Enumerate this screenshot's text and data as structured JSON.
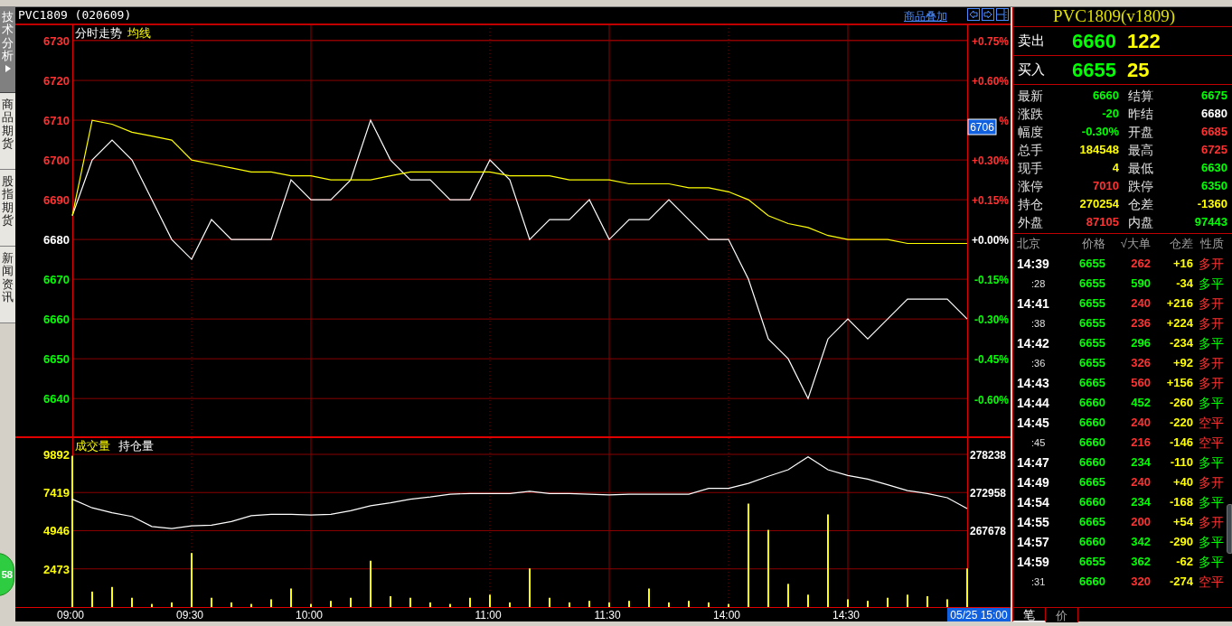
{
  "sidebar": {
    "tabs": [
      {
        "label": "技术分析",
        "selected": true
      },
      {
        "label": "商品期货",
        "selected": false
      },
      {
        "label": "股指期货",
        "selected": false
      },
      {
        "label": "新闻资讯",
        "selected": false
      }
    ],
    "badge": "58"
  },
  "header": {
    "title": "PVC1809 (020609)",
    "overlay_link": "商品叠加"
  },
  "price_chart": {
    "cursor_price": "6706",
    "chart_data": {
      "type": "line",
      "grid": true,
      "ylim": [
        6630.5,
        6734.1
      ],
      "y2lim": [
        -0.741,
        0.81
      ],
      "yticks": [
        {
          "value": 6730,
          "label": "6730"
        },
        {
          "value": 6720,
          "label": "6720"
        },
        {
          "value": 6710,
          "label": "6710"
        },
        {
          "value": 6700,
          "label": "6700"
        },
        {
          "value": 6690,
          "label": "6690"
        },
        {
          "value": 6680,
          "label": "6680"
        },
        {
          "value": 6670,
          "label": "6670"
        },
        {
          "value": 6660,
          "label": "6660"
        },
        {
          "value": 6650,
          "label": "6650"
        },
        {
          "value": 6640,
          "label": "6640"
        }
      ],
      "y2ticks": [
        {
          "value": 0.75,
          "label": "+0.75%"
        },
        {
          "value": 0.6,
          "label": "+0.60%"
        },
        {
          "value": 0.45,
          "label": "%"
        },
        {
          "value": 0.3,
          "label": "+0.30%"
        },
        {
          "value": 0.15,
          "label": "+0.15%"
        },
        {
          "value": 0,
          "label": "+0.00%"
        },
        {
          "value": -0.15,
          "label": "-0.15%"
        },
        {
          "value": -0.3,
          "label": "-0.30%"
        },
        {
          "value": -0.45,
          "label": "-0.45%"
        },
        {
          "value": -0.6,
          "label": "-0.60%"
        }
      ],
      "series": [
        {
          "name": "分时走势",
          "color": "#ffffff",
          "values": [
            6686,
            6700,
            6705,
            6700,
            6690,
            6680,
            6675,
            6685,
            6680,
            6680,
            6680,
            6695,
            6690,
            6690,
            6695,
            6710,
            6700,
            6695,
            6695,
            6690,
            6690,
            6700,
            6695,
            6680,
            6685,
            6685,
            6690,
            6680,
            6685,
            6685,
            6690,
            6685,
            6680,
            6680,
            6670,
            6655,
            6650,
            6640,
            6655,
            6660,
            6655,
            6660,
            6665,
            6665,
            6665,
            6660
          ]
        },
        {
          "name": "均线",
          "color": "#ffff00",
          "values": [
            6686,
            6710,
            6709,
            6707,
            6706,
            6705,
            6700,
            6699,
            6698,
            6697,
            6697,
            6696,
            6696,
            6695,
            6695,
            6695,
            6696,
            6697,
            6697,
            6697,
            6697,
            6697,
            6696,
            6696,
            6696,
            6695,
            6695,
            6695,
            6694,
            6694,
            6694,
            6693,
            6693,
            6692,
            6690,
            6686,
            6684,
            6683,
            6681,
            6680,
            6680,
            6680,
            6679,
            6679,
            6679,
            6679
          ]
        }
      ]
    }
  },
  "volume_chart": {
    "time_label": "05/25 15:00",
    "chart_data": {
      "type": "bar",
      "categories": [
        "09:00",
        null,
        null,
        null,
        null,
        null,
        "09:30",
        null,
        null,
        null,
        null,
        null,
        "10:00",
        null,
        null,
        null,
        null,
        null,
        null,
        null,
        null,
        "11:00",
        null,
        null,
        null,
        null,
        null,
        "11:30",
        null,
        null,
        null,
        null,
        null,
        "14:00",
        null,
        null,
        null,
        null,
        null,
        "14:30",
        null,
        null,
        null,
        null,
        null,
        null
      ],
      "grid": true,
      "ylim": [
        0,
        10828
      ],
      "y2lim": [
        256994,
        280249
      ],
      "yticks": [
        {
          "value": 9892,
          "label": "9892"
        },
        {
          "value": 7419,
          "label": "7419"
        },
        {
          "value": 4946,
          "label": "4946"
        },
        {
          "value": 2473,
          "label": "2473"
        }
      ],
      "y2ticks": [
        {
          "value": 278238,
          "label": "278238"
        },
        {
          "value": 272958,
          "label": "272958"
        },
        {
          "value": 267678,
          "label": "267678"
        }
      ],
      "series": [
        {
          "name": "成交量",
          "color": "#ffff00",
          "values": [
            9800,
            1000,
            1300,
            600,
            200,
            300,
            3500,
            600,
            300,
            200,
            500,
            1200,
            200,
            400,
            600,
            3000,
            700,
            600,
            300,
            200,
            600,
            800,
            300,
            2500,
            600,
            300,
            400,
            300,
            400,
            1200,
            300,
            400,
            300,
            200,
            6700,
            5000,
            1500,
            800,
            6000,
            500,
            400,
            600,
            800,
            700,
            500,
            2500
          ]
        },
        {
          "name": "持仓量",
          "color": "#ffffff",
          "type": "line",
          "axis": "y2",
          "values": [
            272000,
            270800,
            270100,
            269600,
            268200,
            267900,
            268300,
            268400,
            268900,
            269700,
            269900,
            269900,
            269800,
            269900,
            270400,
            271100,
            271500,
            272000,
            272300,
            272700,
            272800,
            272800,
            272800,
            273100,
            272800,
            272800,
            272700,
            272600,
            272700,
            272700,
            272700,
            272700,
            273500,
            273500,
            274200,
            275200,
            276100,
            277900,
            276100,
            275300,
            274800,
            274000,
            273200,
            272800,
            272200,
            270700
          ]
        }
      ]
    }
  },
  "quote": {
    "title": "PVC1809(v1809)",
    "ask": {
      "label": "卖出",
      "price": "6660",
      "volume": "122"
    },
    "bid": {
      "label": "买入",
      "price": "6655",
      "volume": "25"
    },
    "stats": [
      {
        "label": "最新",
        "value": "6660",
        "color": "#00ff00"
      },
      {
        "label": "结算",
        "value": "6675",
        "color": "#00ff00"
      },
      {
        "label": "涨跌",
        "value": "-20",
        "color": "#00ff00"
      },
      {
        "label": "昨结",
        "value": "6680",
        "color": "#ffffff"
      },
      {
        "label": "幅度",
        "value": "-0.30%",
        "color": "#00ff00"
      },
      {
        "label": "开盘",
        "value": "6685",
        "color": "#ff3232"
      },
      {
        "label": "总手",
        "value": "184548",
        "color": "#ffff00"
      },
      {
        "label": "最高",
        "value": "6725",
        "color": "#ff3232"
      },
      {
        "label": "现手",
        "value": "4",
        "color": "#ffff00"
      },
      {
        "label": "最低",
        "value": "6630",
        "color": "#00ff00"
      },
      {
        "label": "涨停",
        "value": "7010",
        "color": "#ff3232"
      },
      {
        "label": "跌停",
        "value": "6350",
        "color": "#00ff00"
      },
      {
        "label": "持仓",
        "value": "270254",
        "color": "#ffff00"
      },
      {
        "label": "仓差",
        "value": "-1360",
        "color": "#ffff00"
      },
      {
        "label": "外盘",
        "value": "87105",
        "color": "#ff3232"
      },
      {
        "label": "内盘",
        "value": "97443",
        "color": "#00ff00"
      }
    ]
  },
  "ticks": {
    "columns": [
      "北京",
      "价格",
      "√大单",
      "仓差",
      "性质"
    ],
    "rows": [
      {
        "time": "14:39",
        "kind": "minute",
        "price": "6655",
        "volume": {
          "text": "262",
          "color": "#ff3232"
        },
        "oi_change": "+16",
        "nature": {
          "text": "多开",
          "color": "#ff3232"
        }
      },
      {
        "time": ":28",
        "kind": "second",
        "price": "6655",
        "volume": {
          "text": "590",
          "color": "#00ff00"
        },
        "oi_change": "-34",
        "nature": {
          "text": "多平",
          "color": "#00ff00"
        }
      },
      {
        "time": "14:41",
        "kind": "minute",
        "price": "6655",
        "volume": {
          "text": "240",
          "color": "#ff3232"
        },
        "oi_change": "+216",
        "nature": {
          "text": "多开",
          "color": "#ff3232"
        }
      },
      {
        "time": ":38",
        "kind": "second",
        "price": "6655",
        "volume": {
          "text": "236",
          "color": "#ff3232"
        },
        "oi_change": "+224",
        "nature": {
          "text": "多开",
          "color": "#ff3232"
        }
      },
      {
        "time": "14:42",
        "kind": "minute",
        "price": "6655",
        "volume": {
          "text": "296",
          "color": "#00ff00"
        },
        "oi_change": "-234",
        "nature": {
          "text": "多平",
          "color": "#00ff00"
        }
      },
      {
        "time": ":36",
        "kind": "second",
        "price": "6655",
        "volume": {
          "text": "326",
          "color": "#ff3232"
        },
        "oi_change": "+92",
        "nature": {
          "text": "多开",
          "color": "#ff3232"
        }
      },
      {
        "time": "14:43",
        "kind": "minute",
        "price": "6665",
        "volume": {
          "text": "560",
          "color": "#ff3232"
        },
        "oi_change": "+156",
        "nature": {
          "text": "多开",
          "color": "#ff3232"
        }
      },
      {
        "time": "14:44",
        "kind": "minute",
        "price": "6660",
        "volume": {
          "text": "452",
          "color": "#00ff00"
        },
        "oi_change": "-260",
        "nature": {
          "text": "多平",
          "color": "#00ff00"
        }
      },
      {
        "time": "14:45",
        "kind": "minute",
        "price": "6660",
        "volume": {
          "text": "240",
          "color": "#ff3232"
        },
        "oi_change": "-220",
        "nature": {
          "text": "空平",
          "color": "#ff3232"
        }
      },
      {
        "time": ":45",
        "kind": "second",
        "price": "6660",
        "volume": {
          "text": "216",
          "color": "#ff3232"
        },
        "oi_change": "-146",
        "nature": {
          "text": "空平",
          "color": "#ff3232"
        }
      },
      {
        "time": "14:47",
        "kind": "minute",
        "price": "6660",
        "volume": {
          "text": "234",
          "color": "#00ff00"
        },
        "oi_change": "-110",
        "nature": {
          "text": "多平",
          "color": "#00ff00"
        }
      },
      {
        "time": "14:49",
        "kind": "minute",
        "price": "6665",
        "volume": {
          "text": "240",
          "color": "#ff3232"
        },
        "oi_change": "+40",
        "nature": {
          "text": "多开",
          "color": "#ff3232"
        }
      },
      {
        "time": "14:54",
        "kind": "minute",
        "price": "6660",
        "volume": {
          "text": "234",
          "color": "#00ff00"
        },
        "oi_change": "-168",
        "nature": {
          "text": "多平",
          "color": "#00ff00"
        }
      },
      {
        "time": "14:55",
        "kind": "minute",
        "price": "6665",
        "volume": {
          "text": "200",
          "color": "#ff3232"
        },
        "oi_change": "+54",
        "nature": {
          "text": "多开",
          "color": "#ff3232"
        }
      },
      {
        "time": "14:57",
        "kind": "minute",
        "price": "6660",
        "volume": {
          "text": "342",
          "color": "#00ff00"
        },
        "oi_change": "-290",
        "nature": {
          "text": "多平",
          "color": "#00ff00"
        }
      },
      {
        "time": "14:59",
        "kind": "minute",
        "price": "6655",
        "volume": {
          "text": "362",
          "color": "#00ff00"
        },
        "oi_change": "-62",
        "nature": {
          "text": "多平",
          "color": "#00ff00"
        }
      },
      {
        "time": ":31",
        "kind": "second",
        "price": "6660",
        "volume": {
          "text": "320",
          "color": "#ff3232"
        },
        "oi_change": "-274",
        "nature": {
          "text": "空平",
          "color": "#ff3232"
        }
      }
    ],
    "tabs": [
      {
        "label": "笔",
        "selected": true
      },
      {
        "label": "价",
        "selected": false
      }
    ]
  }
}
